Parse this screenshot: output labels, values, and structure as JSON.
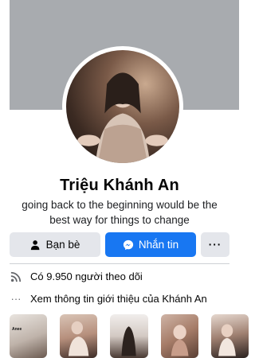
{
  "profile": {
    "name": "Triệu Khánh An",
    "bio": "going back to the beginning would be the best way for things to change"
  },
  "actions": {
    "friends_label": "Bạn bè",
    "message_label": "Nhắn tin",
    "more_label": "···"
  },
  "info": {
    "followers": "Có 9.950 người theo dõi",
    "about": "Xem thông tin giới thiệu của Khánh An",
    "about_icon": "···"
  },
  "thumbnails": {
    "first_label": "Anee"
  },
  "colors": {
    "accent": "#1877f2",
    "button_gray": "#e4e6eb",
    "cover_gray": "#a8abaf"
  },
  "icons": [
    "person-check-icon",
    "messenger-icon",
    "more-icon",
    "rss-icon",
    "ellipsis-icon"
  ]
}
